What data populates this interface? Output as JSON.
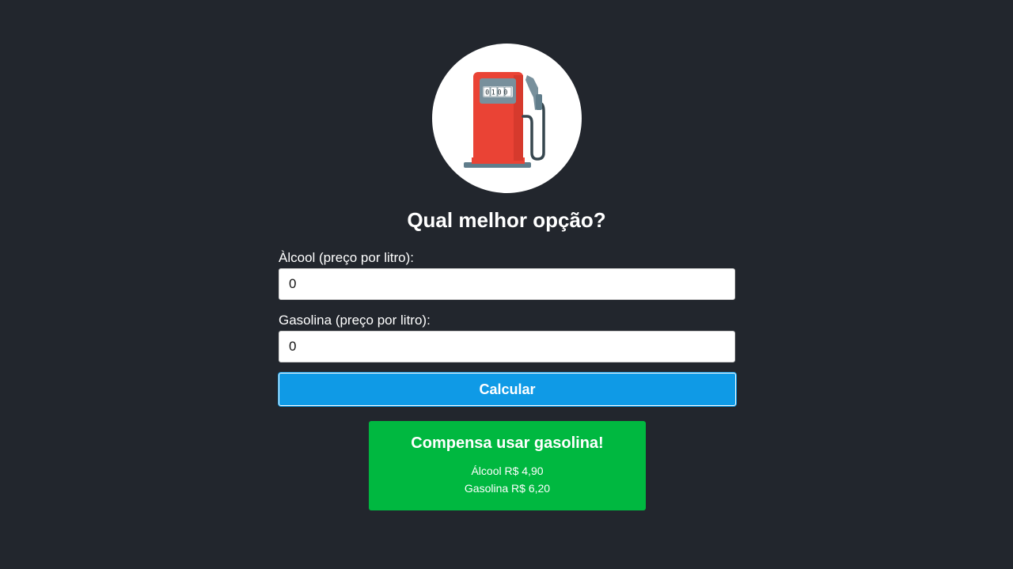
{
  "header": {
    "logo_icon": "gas-pump-icon",
    "pump_display": "0100",
    "title": "Qual melhor opção?"
  },
  "form": {
    "alcool_label": "Àlcool (preço por litro):",
    "alcool_value": "0",
    "gasolina_label": "Gasolina (preço por litro):",
    "gasolina_value": "0",
    "submit_label": "Calcular"
  },
  "result": {
    "title": "Compensa usar gasolina!",
    "alcool_line": "Álcool R$ 4,90",
    "gasolina_line": "Gasolina R$ 6,20"
  },
  "colors": {
    "background": "#22262d",
    "button": "#0f9ae6",
    "result_box": "#00b840",
    "pump_body": "#ea4335"
  }
}
